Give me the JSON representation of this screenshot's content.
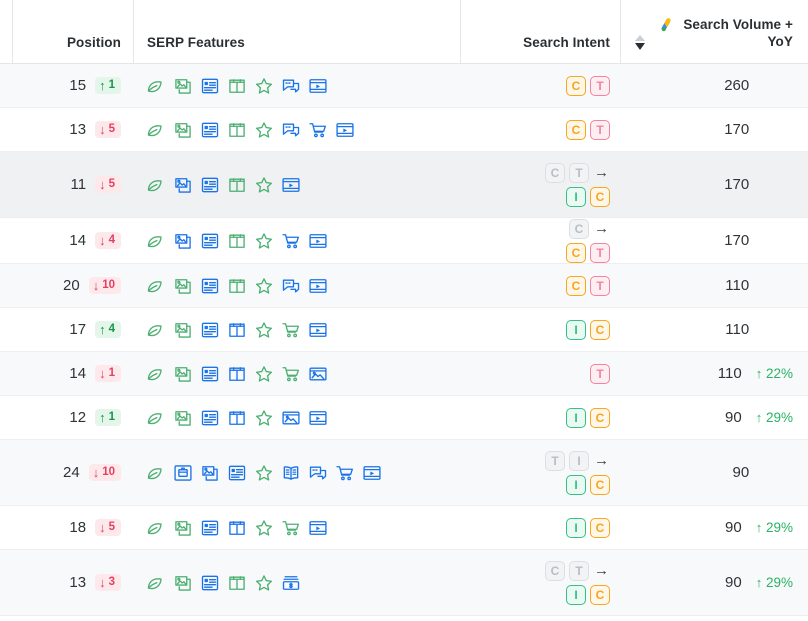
{
  "header": {
    "position_label": "Position",
    "serp_features_label": "SERP Features",
    "search_intent_label": "Search Intent",
    "search_volume_label_line1": "Search Volume +",
    "search_volume_label_line2": "YoY",
    "sort_direction": "desc",
    "source_icon": "google-ads-icon"
  },
  "colors": {
    "intent_informational": "#33c08a",
    "intent_commercial": "#f5a623",
    "intent_transactional": "#f2849e",
    "intent_muted": "#b9bec3",
    "up": "#17954a",
    "down": "#e3405f",
    "yoy": "#29b362",
    "organic_icon": "#4caf72",
    "paid_icon": "#1a73e8"
  },
  "rows": [
    {
      "position": "15",
      "change_dir": "up",
      "change_arrow": "↑",
      "change_value": "1",
      "serp_features": [
        {
          "icon": "leaf-icon",
          "tone": "green"
        },
        {
          "icon": "image-pack-icon",
          "tone": "green"
        },
        {
          "icon": "featured-snippet-icon",
          "tone": "blue"
        },
        {
          "icon": "shopping-pack-icon",
          "tone": "green"
        },
        {
          "icon": "reviews-star-icon",
          "tone": "green"
        },
        {
          "icon": "people-also-ask-icon",
          "tone": "blue"
        },
        {
          "icon": "video-icon",
          "tone": "blue"
        }
      ],
      "intent_previous": [],
      "intent_current": [
        "C",
        "T"
      ],
      "volume": "260",
      "yoy_arrow": "",
      "yoy": ""
    },
    {
      "position": "13",
      "change_dir": "down",
      "change_arrow": "↓",
      "change_value": "5",
      "serp_features": [
        {
          "icon": "leaf-icon",
          "tone": "green"
        },
        {
          "icon": "image-pack-icon",
          "tone": "green"
        },
        {
          "icon": "featured-snippet-icon",
          "tone": "blue"
        },
        {
          "icon": "shopping-pack-icon",
          "tone": "green"
        },
        {
          "icon": "reviews-star-icon",
          "tone": "green"
        },
        {
          "icon": "people-also-ask-icon",
          "tone": "blue"
        },
        {
          "icon": "shopping-cart-icon",
          "tone": "blue"
        },
        {
          "icon": "video-icon",
          "tone": "blue"
        }
      ],
      "intent_previous": [],
      "intent_current": [
        "C",
        "T"
      ],
      "volume": "170",
      "yoy_arrow": "",
      "yoy": ""
    },
    {
      "position": "11",
      "change_dir": "down",
      "change_arrow": "↓",
      "change_value": "5",
      "serp_features": [
        {
          "icon": "leaf-icon",
          "tone": "green"
        },
        {
          "icon": "image-pack-icon",
          "tone": "blue"
        },
        {
          "icon": "featured-snippet-icon",
          "tone": "blue"
        },
        {
          "icon": "shopping-pack-icon",
          "tone": "green"
        },
        {
          "icon": "reviews-star-icon",
          "tone": "green"
        },
        {
          "icon": "video-icon",
          "tone": "blue"
        }
      ],
      "intent_previous": [
        "C",
        "T"
      ],
      "intent_current": [
        "I",
        "C"
      ],
      "volume": "170",
      "yoy_arrow": "",
      "yoy": ""
    },
    {
      "position": "14",
      "change_dir": "down",
      "change_arrow": "↓",
      "change_value": "4",
      "serp_features": [
        {
          "icon": "leaf-icon",
          "tone": "green"
        },
        {
          "icon": "image-pack-icon",
          "tone": "blue"
        },
        {
          "icon": "featured-snippet-icon",
          "tone": "blue"
        },
        {
          "icon": "shopping-pack-icon",
          "tone": "green"
        },
        {
          "icon": "reviews-star-icon",
          "tone": "green"
        },
        {
          "icon": "shopping-cart-icon",
          "tone": "blue"
        },
        {
          "icon": "video-icon",
          "tone": "blue"
        }
      ],
      "intent_previous": [
        "C"
      ],
      "intent_current": [
        "C",
        "T"
      ],
      "volume": "170",
      "yoy_arrow": "",
      "yoy": ""
    },
    {
      "position": "20",
      "change_dir": "down",
      "change_arrow": "↓",
      "change_value": "10",
      "serp_features": [
        {
          "icon": "leaf-icon",
          "tone": "green"
        },
        {
          "icon": "image-pack-icon",
          "tone": "green"
        },
        {
          "icon": "featured-snippet-icon",
          "tone": "blue"
        },
        {
          "icon": "shopping-pack-icon",
          "tone": "green"
        },
        {
          "icon": "reviews-star-icon",
          "tone": "green"
        },
        {
          "icon": "people-also-ask-icon",
          "tone": "blue"
        },
        {
          "icon": "video-icon",
          "tone": "blue"
        }
      ],
      "intent_previous": [],
      "intent_current": [
        "C",
        "T"
      ],
      "volume": "110",
      "yoy_arrow": "",
      "yoy": ""
    },
    {
      "position": "17",
      "change_dir": "up",
      "change_arrow": "↑",
      "change_value": "4",
      "serp_features": [
        {
          "icon": "leaf-icon",
          "tone": "green"
        },
        {
          "icon": "image-pack-icon",
          "tone": "green"
        },
        {
          "icon": "featured-snippet-icon",
          "tone": "blue"
        },
        {
          "icon": "shopping-pack-icon",
          "tone": "blue"
        },
        {
          "icon": "reviews-star-icon",
          "tone": "green"
        },
        {
          "icon": "shopping-cart-icon",
          "tone": "green"
        },
        {
          "icon": "video-icon",
          "tone": "blue"
        }
      ],
      "intent_previous": [],
      "intent_current": [
        "I",
        "C"
      ],
      "volume": "110",
      "yoy_arrow": "",
      "yoy": ""
    },
    {
      "position": "14",
      "change_dir": "down",
      "change_arrow": "↓",
      "change_value": "1",
      "serp_features": [
        {
          "icon": "leaf-icon",
          "tone": "green"
        },
        {
          "icon": "image-pack-icon",
          "tone": "green"
        },
        {
          "icon": "featured-snippet-icon",
          "tone": "blue"
        },
        {
          "icon": "shopping-pack-icon",
          "tone": "blue"
        },
        {
          "icon": "reviews-star-icon",
          "tone": "green"
        },
        {
          "icon": "shopping-cart-icon",
          "tone": "green"
        },
        {
          "icon": "image-carousel-icon",
          "tone": "blue"
        }
      ],
      "intent_previous": [],
      "intent_current": [
        "T"
      ],
      "volume": "110",
      "yoy_arrow": "↑",
      "yoy": "22%"
    },
    {
      "position": "12",
      "change_dir": "up",
      "change_arrow": "↑",
      "change_value": "1",
      "serp_features": [
        {
          "icon": "leaf-icon",
          "tone": "green"
        },
        {
          "icon": "image-pack-icon",
          "tone": "green"
        },
        {
          "icon": "featured-snippet-icon",
          "tone": "blue"
        },
        {
          "icon": "shopping-pack-icon",
          "tone": "blue"
        },
        {
          "icon": "reviews-star-icon",
          "tone": "green"
        },
        {
          "icon": "image-carousel-icon",
          "tone": "blue"
        },
        {
          "icon": "video-icon",
          "tone": "blue"
        }
      ],
      "intent_previous": [],
      "intent_current": [
        "I",
        "C"
      ],
      "volume": "90",
      "yoy_arrow": "↑",
      "yoy": "29%"
    },
    {
      "position": "24",
      "change_dir": "down",
      "change_arrow": "↓",
      "change_value": "10",
      "serp_features": [
        {
          "icon": "leaf-icon",
          "tone": "green"
        },
        {
          "icon": "product-box-icon",
          "tone": "blue"
        },
        {
          "icon": "image-pack-icon",
          "tone": "blue"
        },
        {
          "icon": "featured-snippet-icon",
          "tone": "blue"
        },
        {
          "icon": "reviews-star-icon",
          "tone": "green"
        },
        {
          "icon": "knowledge-panel-icon",
          "tone": "blue"
        },
        {
          "icon": "people-also-ask-icon",
          "tone": "blue"
        },
        {
          "icon": "shopping-cart-icon",
          "tone": "blue"
        },
        {
          "icon": "video-icon",
          "tone": "blue"
        }
      ],
      "intent_previous": [
        "T",
        "I"
      ],
      "intent_current": [
        "I",
        "C"
      ],
      "volume": "90",
      "yoy_arrow": "",
      "yoy": ""
    },
    {
      "position": "18",
      "change_dir": "down",
      "change_arrow": "↓",
      "change_value": "5",
      "serp_features": [
        {
          "icon": "leaf-icon",
          "tone": "green"
        },
        {
          "icon": "image-pack-icon",
          "tone": "green"
        },
        {
          "icon": "featured-snippet-icon",
          "tone": "blue"
        },
        {
          "icon": "shopping-pack-icon",
          "tone": "blue"
        },
        {
          "icon": "reviews-star-icon",
          "tone": "green"
        },
        {
          "icon": "shopping-cart-icon",
          "tone": "green"
        },
        {
          "icon": "video-icon",
          "tone": "blue"
        }
      ],
      "intent_previous": [],
      "intent_current": [
        "I",
        "C"
      ],
      "volume": "90",
      "yoy_arrow": "↑",
      "yoy": "29%"
    },
    {
      "position": "13",
      "change_dir": "down",
      "change_arrow": "↓",
      "change_value": "3",
      "serp_features": [
        {
          "icon": "leaf-icon",
          "tone": "green"
        },
        {
          "icon": "image-pack-icon",
          "tone": "green"
        },
        {
          "icon": "featured-snippet-icon",
          "tone": "blue"
        },
        {
          "icon": "shopping-pack-icon",
          "tone": "green"
        },
        {
          "icon": "reviews-star-icon",
          "tone": "green"
        },
        {
          "icon": "price-icon",
          "tone": "blue"
        }
      ],
      "intent_previous": [
        "C",
        "T"
      ],
      "intent_current": [
        "I",
        "C"
      ],
      "volume": "90",
      "yoy_arrow": "↑",
      "yoy": "29%"
    }
  ]
}
